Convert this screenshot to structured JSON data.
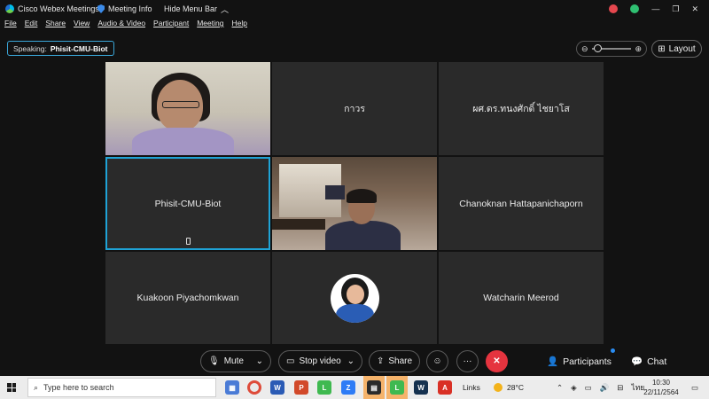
{
  "titlebar": {
    "app_name": "Cisco Webex Meetings",
    "meeting_info": "Meeting Info",
    "hide_menu_bar": "Hide Menu Bar"
  },
  "menu": [
    "File",
    "Edit",
    "Share",
    "View",
    "Audio & Video",
    "Participant",
    "Meeting",
    "Help"
  ],
  "speaking": {
    "label": "Speaking:",
    "name": "Phisit-CMU-Biot"
  },
  "layout_button": "Layout",
  "tiles": [
    {
      "name": "",
      "kind": "video"
    },
    {
      "name": "กาวร",
      "kind": "name"
    },
    {
      "name": "ผศ.ดร.ทนงศักดิ์ ไชยาโส",
      "kind": "name"
    },
    {
      "name": "Phisit-CMU-Biot",
      "kind": "name",
      "active": true
    },
    {
      "name": "",
      "kind": "video"
    },
    {
      "name": "Chanoknan Hattapanichaporn",
      "kind": "name"
    },
    {
      "name": "Kuakoon Piyachomkwan",
      "kind": "name"
    },
    {
      "name": "",
      "kind": "avatar"
    },
    {
      "name": "Watcharin Meerod",
      "kind": "name"
    }
  ],
  "controls": {
    "mute": "Mute",
    "stop_video": "Stop video",
    "share": "Share",
    "more": "···",
    "end": "✕",
    "participants": "Participants",
    "chat": "Chat"
  },
  "taskbar": {
    "search_placeholder": "Type here to search",
    "links": "Links",
    "temperature": "28°C",
    "language": "ไทย",
    "time": "10:30",
    "date": "22/11/2564"
  },
  "colors": {
    "accent": "#1fa3d6",
    "end_call": "#e5343f",
    "tile_bg": "#2a2a2a",
    "background": "#121212"
  }
}
